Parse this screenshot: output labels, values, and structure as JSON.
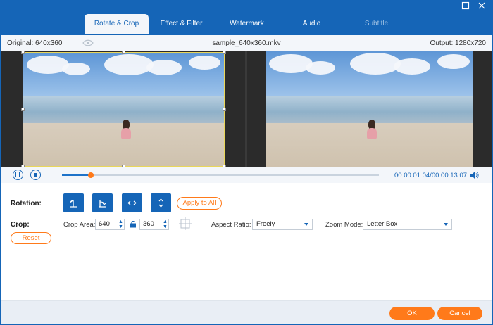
{
  "tabs": [
    {
      "label": "Rotate & Crop"
    },
    {
      "label": "Effect & Filter"
    },
    {
      "label": "Watermark"
    },
    {
      "label": "Audio"
    },
    {
      "label": "Subtitle"
    }
  ],
  "info": {
    "original": "Original: 640x360",
    "filename": "sample_640x360.mkv",
    "output": "Output: 1280x720"
  },
  "playback": {
    "timecode": "00:00:01.04/00:00:13.07",
    "progress": 0.09
  },
  "rotation": {
    "label": "Rotation:",
    "buttons": [
      "rotate-left-icon",
      "rotate-right-icon",
      "flip-horizontal-icon",
      "flip-vertical-icon"
    ],
    "apply_all": "Apply to All"
  },
  "crop": {
    "label": "Crop:",
    "area_label": "Crop Area:",
    "width": "640",
    "height": "360",
    "aspect_label": "Aspect Ratio:",
    "aspect_value": "Freely",
    "zoom_label": "Zoom Mode:",
    "zoom_value": "Letter Box",
    "reset": "Reset"
  },
  "footer": {
    "ok": "OK",
    "cancel": "Cancel"
  },
  "colors": {
    "accent": "#1565b7",
    "action": "#ff7a1a"
  }
}
